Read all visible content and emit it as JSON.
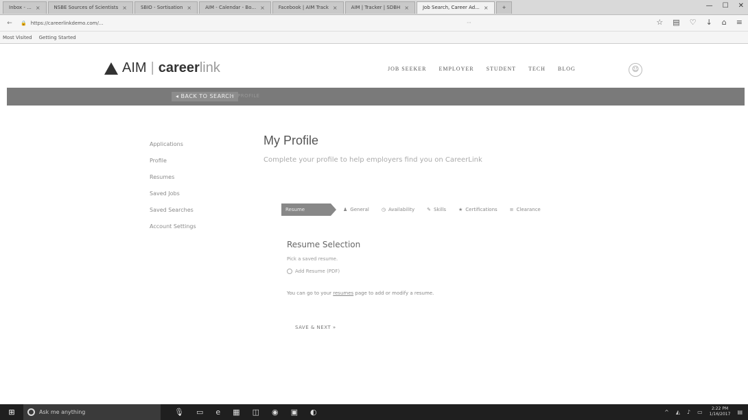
{
  "browser": {
    "tabs": [
      {
        "label": "Inbox - ...",
        "active": false
      },
      {
        "label": "NSBE Sources of Scientists",
        "active": false
      },
      {
        "label": "SBIO - Sortisation",
        "active": false
      },
      {
        "label": "AIM - Calendar - Bo...",
        "active": false
      },
      {
        "label": "Facebook | AIM Track",
        "active": false
      },
      {
        "label": "AIM | Tracker | SDBH",
        "active": false
      },
      {
        "label": "Job Search, Career Ad...",
        "active": true
      }
    ],
    "url": "https://careerlinkdemo.com/...",
    "bookmarks": [
      "Most Visited",
      "Getting Started"
    ]
  },
  "site": {
    "logo_aim": "AIM",
    "logo_career": "career",
    "logo_link": "link",
    "menu": [
      "JOB SEEKER",
      "EMPLOYER",
      "STUDENT",
      "TECH",
      "BLOG"
    ]
  },
  "band": {
    "back_label": "◂ BACK TO SEARCH",
    "crumb": "MY PROFILE"
  },
  "sidebar": {
    "items": [
      {
        "label": "Applications"
      },
      {
        "label": "Profile"
      },
      {
        "label": "Resumes"
      },
      {
        "label": "Saved Jobs"
      },
      {
        "label": "Saved Searches"
      },
      {
        "label": "Account Settings"
      }
    ]
  },
  "main": {
    "title": "My Profile",
    "subtitle": "Complete your profile to help employers find you on CareerLink",
    "steps": {
      "active": "Resume",
      "items": [
        "General",
        "Availability",
        "Skills",
        "Certifications",
        "Clearance"
      ]
    },
    "section_title": "Resume Selection",
    "pick_label": "Pick a saved resume.",
    "radio_label": "Add Resume (PDF)",
    "note_pre": "You can go to your ",
    "note_link": "resumes",
    "note_post": " page to add or modify a resume.",
    "save_label": "SAVE & NEXT »"
  },
  "taskbar": {
    "search_placeholder": "Ask me anything",
    "time": "2:22 PM",
    "date": "1/16/2017"
  }
}
